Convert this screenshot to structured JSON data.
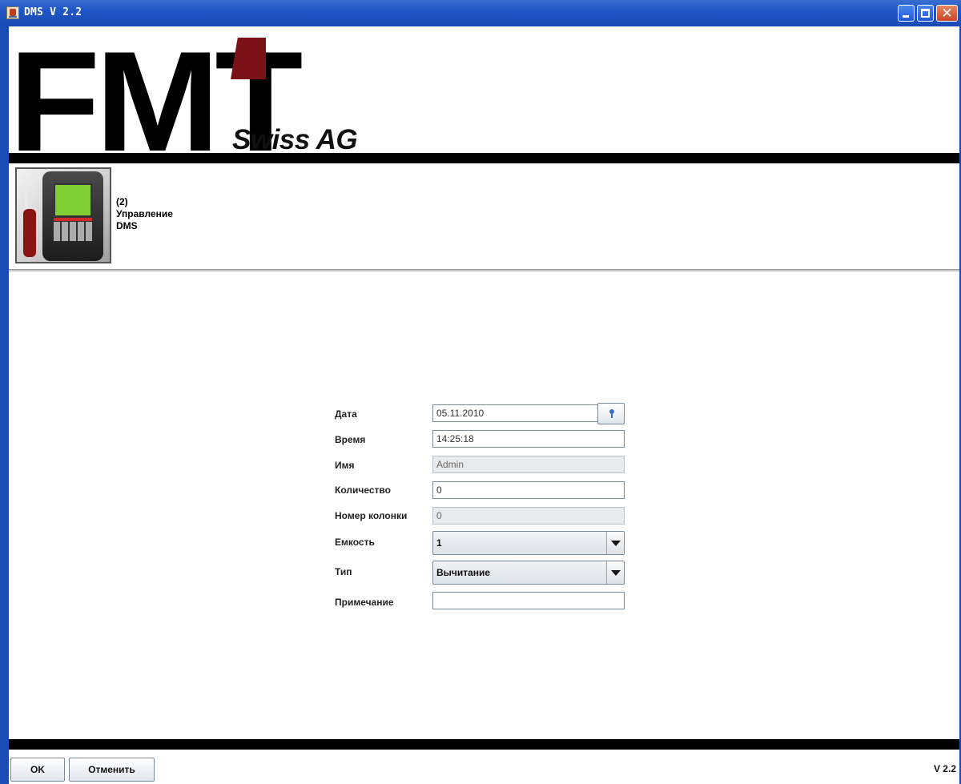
{
  "window": {
    "title": "DMS V 2.2"
  },
  "logo": {
    "brand_text": "FMT",
    "tagline": "Swiss AG"
  },
  "module": {
    "line1": "(2)",
    "line2": "Управление",
    "line3": "DMS"
  },
  "form": {
    "date_label": "Дата",
    "date_value": "05.11.2010",
    "time_label": "Время",
    "time_value": "14:25:18",
    "name_label": "Имя",
    "name_value": "Admin",
    "quantity_label": "Количество",
    "quantity_value": "0",
    "pump_label": "Номер колонки",
    "pump_value": "0",
    "tank_label": "Емкость",
    "tank_value": "1",
    "type_label": "Тип",
    "type_value": "Вычитание",
    "note_label": "Примечание",
    "note_value": ""
  },
  "footer": {
    "ok_label": "OK",
    "cancel_label": "Отменить",
    "version": "V 2.2"
  }
}
